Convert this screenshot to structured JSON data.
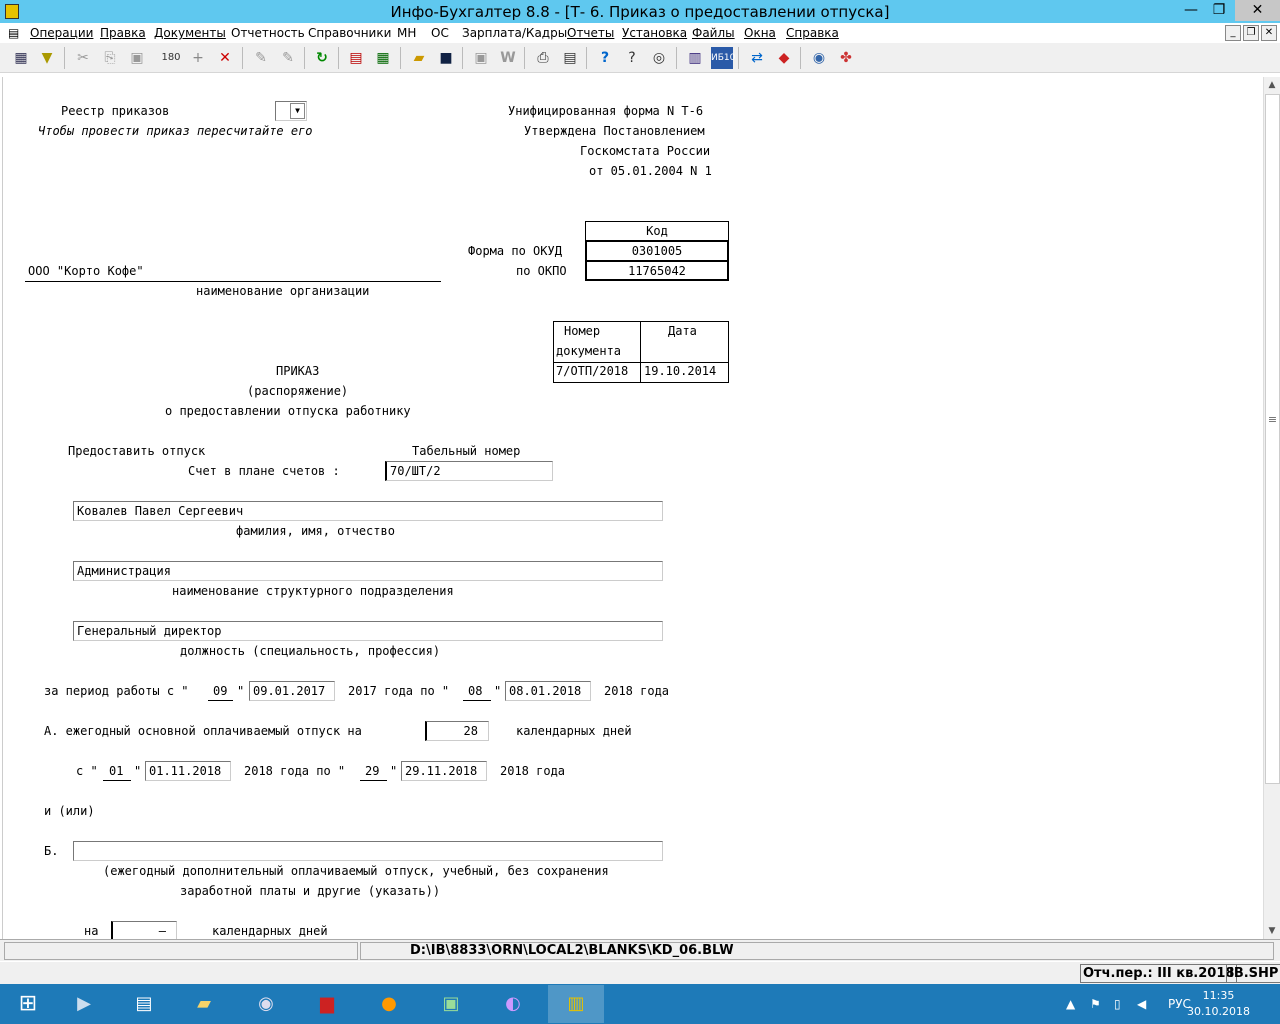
{
  "window": {
    "title": "Инфо-Бухгалтер 8.8 - [Т- 6. Приказ о предоставлении отпуска]"
  },
  "menu": [
    "Операции",
    "Правка",
    "Документы",
    "Отчетность",
    "Справочники",
    "МН",
    "ОС",
    "Зарплата/Кадры",
    "Отчеты",
    "Установка",
    "Файлы",
    "Окна",
    "Справка"
  ],
  "doc": {
    "registry_label": "Реестр приказов",
    "recalc_hint": "Чтобы провести приказ пересчитайте его",
    "unified_form": "Унифицированная форма N Т-6",
    "approved": "Утверждена Постановлением",
    "goskomstat": "Госкомстата России",
    "decree_date": "от 05.01.2004 N 1",
    "code_header": "Код",
    "okud_label": "Форма по ОКУД",
    "okud_value": "0301005",
    "okpo_label": "по ОКПО",
    "okpo_value": "11765042",
    "org_name": "ООО \"Корто Кофе\"",
    "org_caption": "наименование организации",
    "doc_number_header1": "Номер",
    "doc_number_header2": "документа",
    "date_header": "Дата",
    "doc_number": "7/ОТП/2018",
    "doc_date": "19.10.2014",
    "order_title": "ПРИКАЗ",
    "order_sub": "(распоряжение)",
    "order_desc": "о предоставлении отпуска работнику",
    "grant_label": "Предоставить отпуск",
    "tab_number_label": "Табельный номер",
    "account_label": "Счет в плане счетов :",
    "account_value": "70/ШТ/2",
    "fio_value": "Ковалев Павел Сергеевич",
    "fio_caption": "фамилия, имя, отчество",
    "dept_value": "Администрация",
    "dept_caption": "наименование структурного подразделения",
    "position_value": "Генеральный директор",
    "position_caption": "должность (специальность, профессия)",
    "period_prefix": "за период работы с \"",
    "period_day_from": "09",
    "period_date_from": "09.01.2017",
    "period_mid": "2017 года по \"",
    "period_day_to": "08",
    "period_date_to": "08.01.2018",
    "period_suffix": "2018 года",
    "quote": "\"",
    "a_label": "А. ежегодный основной оплачиваемый отпуск на",
    "a_days": "28",
    "a_days_caption": "календарных дней",
    "from_prefix": "с \"",
    "from_day": "01",
    "from_date": "01.11.2018",
    "from_mid": "2018 года по \"",
    "to_day": "29",
    "to_date": "29.11.2018",
    "to_suffix": "2018 года",
    "and_or": "и (или)",
    "b_label": "Б.",
    "b_caption1": "(ежегодный дополнительный оплачиваемый отпуск, учебный, без сохранения",
    "b_caption2": "заработной платы и другие (указать))",
    "na_label": "на",
    "na_value": "–",
    "na_caption": "календарных дней"
  },
  "path": "D:\\IB\\8833\\ORN\\LOCAL2\\BLANKS\\KD_06.BLW",
  "status": {
    "period": "Отч.пер.: III кв.2018",
    "db": "IB.SHP"
  },
  "taskbar": {
    "lang": "РУС",
    "time": "11:35",
    "date": "30.10.2018"
  }
}
